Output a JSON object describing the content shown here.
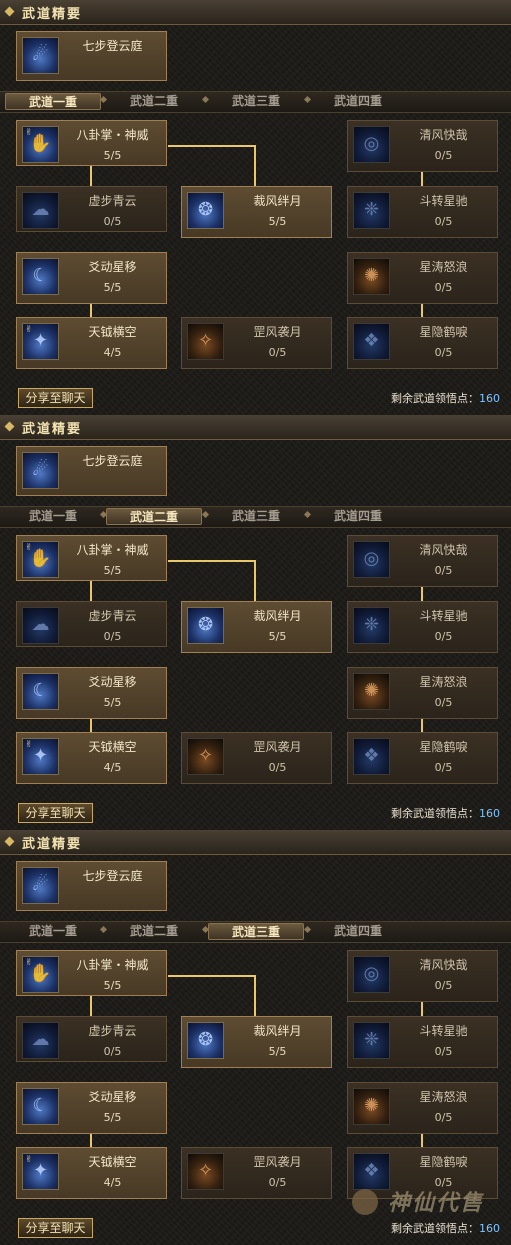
{
  "panels": [
    {
      "header": "武道精要",
      "top_skill": {
        "name": "七步登云庭"
      },
      "tabs": [
        "武道一重",
        "武道二重",
        "武道三重",
        "武道四重"
      ],
      "active_tab": 0,
      "skills": [
        {
          "name": "八卦掌・神威",
          "level": "5/5",
          "icon": "palm-strike-icon"
        },
        {
          "name": "虚步青云",
          "level": "0/5",
          "icon": "cloud-step-icon"
        },
        {
          "name": "爻动星移",
          "level": "5/5",
          "icon": "star-shift-icon"
        },
        {
          "name": "天钺横空",
          "level": "4/5",
          "icon": "sky-axe-icon"
        },
        {
          "name": "裁风绊月",
          "level": "5/5",
          "icon": "wind-moon-icon"
        },
        {
          "name": "罡风袭月",
          "level": "0/5",
          "icon": "gale-moon-icon"
        },
        {
          "name": "清风快哉",
          "level": "0/5",
          "icon": "breeze-icon"
        },
        {
          "name": "斗转星驰",
          "level": "0/5",
          "icon": "star-gallop-icon"
        },
        {
          "name": "星涛怒浪",
          "level": "0/5",
          "icon": "star-wave-icon"
        },
        {
          "name": "星隐鹤唳",
          "level": "0/5",
          "icon": "crane-cry-icon"
        }
      ],
      "share_button": "分享至聊天",
      "points_label": "剩余武道领悟点：",
      "points_value": "160"
    },
    {
      "header": "武道精要",
      "top_skill": {
        "name": "七步登云庭"
      },
      "tabs": [
        "武道一重",
        "武道二重",
        "武道三重",
        "武道四重"
      ],
      "active_tab": 1,
      "skills": [
        {
          "name": "八卦掌・神威",
          "level": "5/5",
          "icon": "palm-strike-icon"
        },
        {
          "name": "虚步青云",
          "level": "0/5",
          "icon": "cloud-step-icon"
        },
        {
          "name": "爻动星移",
          "level": "5/5",
          "icon": "star-shift-icon"
        },
        {
          "name": "天钺横空",
          "level": "4/5",
          "icon": "sky-axe-icon"
        },
        {
          "name": "裁风绊月",
          "level": "5/5",
          "icon": "wind-moon-icon"
        },
        {
          "name": "罡风袭月",
          "level": "0/5",
          "icon": "gale-moon-icon"
        },
        {
          "name": "清风快哉",
          "level": "0/5",
          "icon": "breeze-icon"
        },
        {
          "name": "斗转星驰",
          "level": "0/5",
          "icon": "star-gallop-icon"
        },
        {
          "name": "星涛怒浪",
          "level": "0/5",
          "icon": "star-wave-icon"
        },
        {
          "name": "星隐鹤唳",
          "level": "0/5",
          "icon": "crane-cry-icon"
        }
      ],
      "share_button": "分享至聊天",
      "points_label": "剩余武道领悟点：",
      "points_value": "160"
    },
    {
      "header": "武道精要",
      "top_skill": {
        "name": "七步登云庭"
      },
      "tabs": [
        "武道一重",
        "武道二重",
        "武道三重",
        "武道四重"
      ],
      "active_tab": 2,
      "skills": [
        {
          "name": "八卦掌・神威",
          "level": "5/5",
          "icon": "palm-strike-icon"
        },
        {
          "name": "虚步青云",
          "level": "0/5",
          "icon": "cloud-step-icon"
        },
        {
          "name": "爻动星移",
          "level": "5/5",
          "icon": "star-shift-icon"
        },
        {
          "name": "天钺横空",
          "level": "4/5",
          "icon": "sky-axe-icon"
        },
        {
          "name": "裁风绊月",
          "level": "5/5",
          "icon": "wind-moon-icon"
        },
        {
          "name": "罡风袭月",
          "level": "0/5",
          "icon": "gale-moon-icon"
        },
        {
          "name": "清风快哉",
          "level": "0/5",
          "icon": "breeze-icon"
        },
        {
          "name": "斗转星驰",
          "level": "0/5",
          "icon": "star-gallop-icon"
        },
        {
          "name": "星涛怒浪",
          "level": "0/5",
          "icon": "star-wave-icon"
        },
        {
          "name": "星隐鹤唳",
          "level": "0/5",
          "icon": "crane-cry-icon"
        }
      ],
      "share_button": "分享至聊天",
      "points_label": "剩余武道领悟点：",
      "points_value": "160"
    }
  ],
  "watermark": "神仙代售",
  "colors": {
    "accent_gold": "#e8c86a",
    "points_blue": "#7ec4ff",
    "text_cream": "#f3e3b2"
  }
}
